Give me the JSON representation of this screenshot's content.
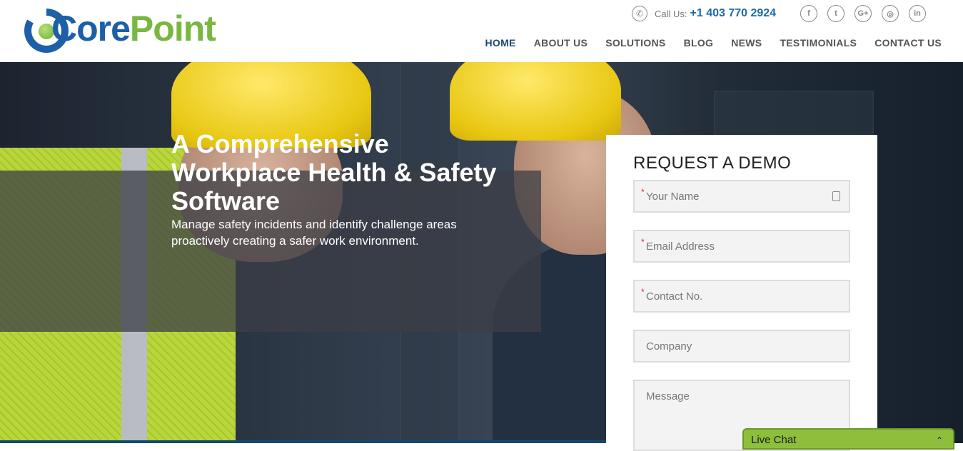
{
  "brand": {
    "logo_part1": "Core",
    "logo_part2": "Point"
  },
  "contact": {
    "call_label": "Call Us:",
    "phone": "+1 403 770 2924"
  },
  "socials": [
    {
      "name": "facebook",
      "glyph": "f"
    },
    {
      "name": "twitter",
      "glyph": "t"
    },
    {
      "name": "google-plus",
      "glyph": "G+"
    },
    {
      "name": "instagram",
      "glyph": "◎"
    },
    {
      "name": "linkedin",
      "glyph": "in"
    }
  ],
  "nav": [
    {
      "label": "HOME"
    },
    {
      "label": "ABOUT US"
    },
    {
      "label": "SOLUTIONS"
    },
    {
      "label": "BLOG"
    },
    {
      "label": "NEWS"
    },
    {
      "label": "TESTIMONIALS"
    },
    {
      "label": "CONTACT US"
    }
  ],
  "hero": {
    "title": "A Comprehensive Workplace Health & Safety Software",
    "subtitle": "Manage safety incidents and identify challenge areas proactively creating a safer work environment."
  },
  "form": {
    "title": "REQUEST A DEMO",
    "fields": {
      "name": "Your Name",
      "email": "Email Address",
      "contact": "Contact No.",
      "company": "Company",
      "message": "Message"
    },
    "required_mark": "*"
  },
  "chat": {
    "label": "Live Chat",
    "chevron": "⌃"
  },
  "colors": {
    "brand_blue": "#1d5fa8",
    "brand_green": "#7ab740",
    "nav_active": "#1b4a73",
    "chat_green": "#8dbf3c"
  }
}
